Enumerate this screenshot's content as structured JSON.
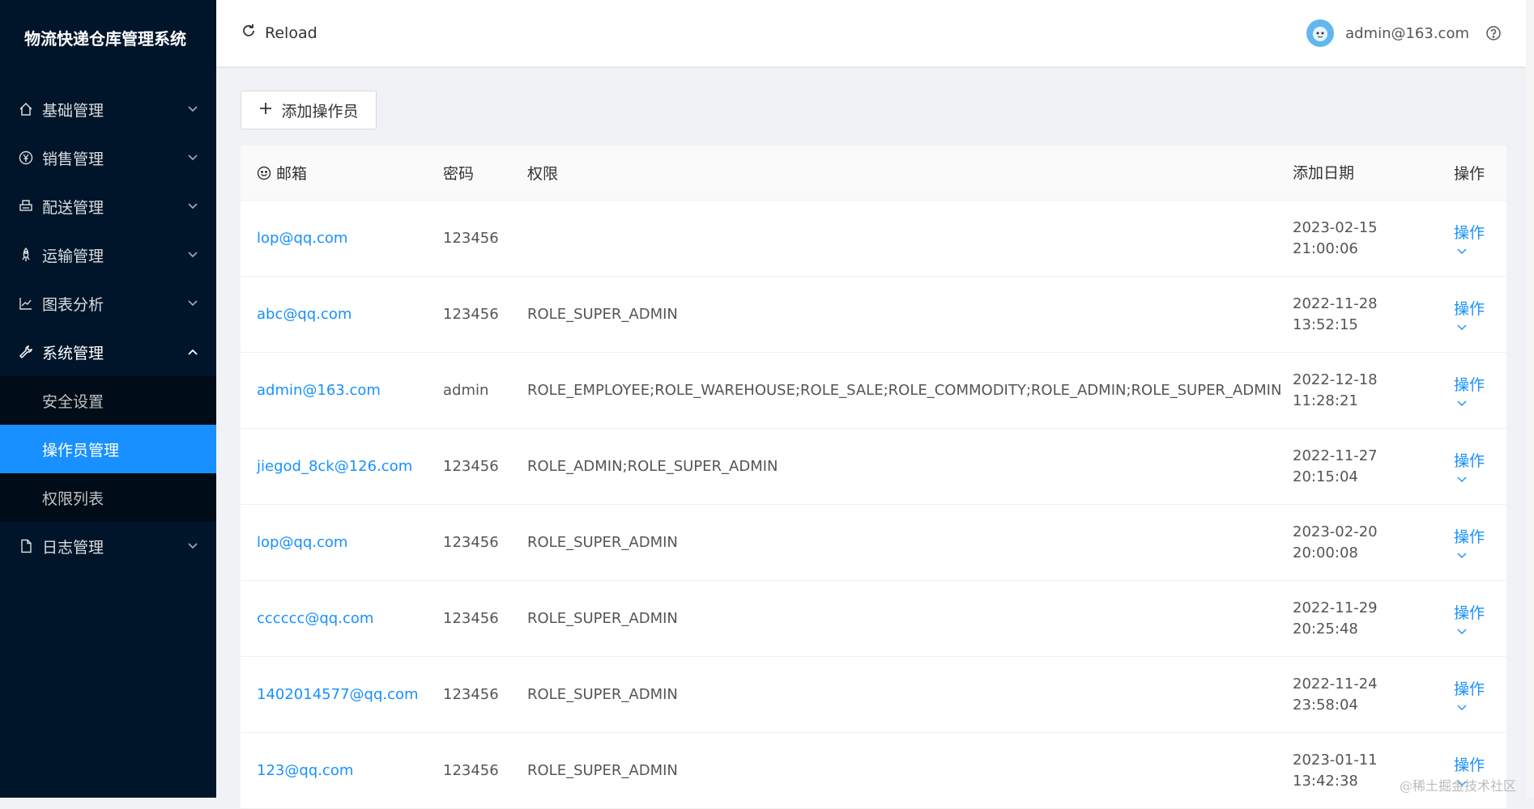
{
  "sidebar": {
    "title": "物流快递仓库管理系统",
    "menu": [
      {
        "label": "基础管理",
        "icon": "home-icon"
      },
      {
        "label": "销售管理",
        "icon": "yen-icon"
      },
      {
        "label": "配送管理",
        "icon": "printer-icon"
      },
      {
        "label": "运输管理",
        "icon": "rocket-icon"
      },
      {
        "label": "图表分析",
        "icon": "line-chart-icon"
      },
      {
        "label": "系统管理",
        "icon": "tool-icon",
        "open": true
      },
      {
        "label": "日志管理",
        "icon": "file-icon"
      }
    ],
    "submenu": [
      "安全设置",
      "操作员管理",
      "权限列表"
    ],
    "active_sub": "操作员管理"
  },
  "header": {
    "reload_label": "Reload",
    "user_email": "admin@163.com"
  },
  "toolbar": {
    "add_label": "添加操作员"
  },
  "table": {
    "columns": {
      "email": "邮箱",
      "password": "密码",
      "role": "权限",
      "date": "添加日期",
      "action": "操作"
    },
    "rows": [
      {
        "email": "lop@qq.com",
        "password": "123456",
        "role": "",
        "date": "2023-02-15",
        "time": "21:00:06",
        "action": "操作"
      },
      {
        "email": "abc@qq.com",
        "password": "123456",
        "role": "ROLE_SUPER_ADMIN",
        "date": "2022-11-28",
        "time": "13:52:15",
        "action": "操作"
      },
      {
        "email": "admin@163.com",
        "password": "admin",
        "role": "ROLE_EMPLOYEE;ROLE_WAREHOUSE;ROLE_SALE;ROLE_COMMODITY;ROLE_ADMIN;ROLE_SUPER_ADMIN",
        "date": "2022-12-18",
        "time": "11:28:21",
        "action": "操作"
      },
      {
        "email": "jiegod_8ck@126.com",
        "password": "123456",
        "role": "ROLE_ADMIN;ROLE_SUPER_ADMIN",
        "date": "2022-11-27",
        "time": "20:15:04",
        "action": "操作"
      },
      {
        "email": "lop@qq.com",
        "password": "123456",
        "role": "ROLE_SUPER_ADMIN",
        "date": "2023-02-20",
        "time": "20:00:08",
        "action": "操作"
      },
      {
        "email": "cccccc@qq.com",
        "password": "123456",
        "role": "ROLE_SUPER_ADMIN",
        "date": "2022-11-29",
        "time": "20:25:48",
        "action": "操作"
      },
      {
        "email": "1402014577@qq.com",
        "password": "123456",
        "role": "ROLE_SUPER_ADMIN",
        "date": "2022-11-24",
        "time": "23:58:04",
        "action": "操作"
      },
      {
        "email": "123@qq.com",
        "password": "123456",
        "role": "ROLE_SUPER_ADMIN",
        "date": "2023-01-11",
        "time": "13:42:38",
        "action": "操作"
      }
    ]
  },
  "watermark": "@稀土掘金技术社区",
  "colors": {
    "sidebar_bg": "#001529",
    "accent": "#1890ff",
    "submenu_bg": "#000c17"
  }
}
